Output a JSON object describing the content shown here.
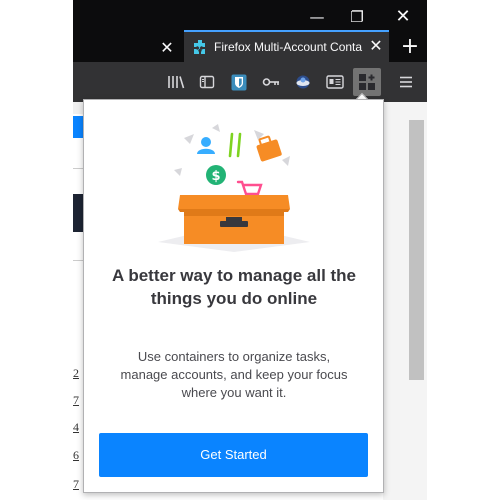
{
  "window": {
    "controls": {
      "minimize": "—",
      "restore": "❐",
      "close": "✕"
    }
  },
  "tabs": {
    "inactive_close": "✕",
    "active": {
      "title": "Firefox Multi-Account Conta",
      "close": "✕",
      "icon": "puzzle-icon"
    },
    "new_tab": "+"
  },
  "toolbar": {
    "icons": [
      "library-icon",
      "sidebar-icon",
      "bitwarden-shield-icon",
      "key-icon",
      "globe-extension-icon",
      "reader-view-icon",
      "containers-icon",
      "hamburger-menu-icon"
    ]
  },
  "page": {
    "visible_numbers": [
      "2",
      "7",
      "4",
      "6",
      "7"
    ]
  },
  "popup": {
    "headline": "A better way to manage all the things you do online",
    "description": "Use containers to organize tasks, manage accounts, and keep your focus where you want it.",
    "primary_button": "Get Started"
  },
  "colors": {
    "accent": "#0a84ff",
    "tab_highlight": "#45a1ff",
    "chrome_dark": "#0c0c0d",
    "toolbar": "#323234",
    "box_orange": "#f68c25",
    "headline_text": "#38383d"
  }
}
